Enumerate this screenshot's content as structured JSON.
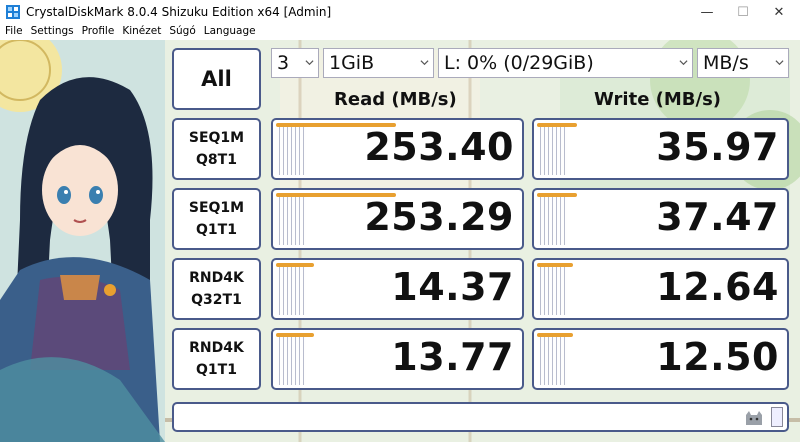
{
  "window": {
    "title": "CrystalDiskMark 8.0.4 Shizuku Edition x64 [Admin]",
    "minimize_glyph": "—",
    "maximize_glyph": "☐",
    "close_glyph": "✕"
  },
  "menu": {
    "items": [
      "File",
      "Settings",
      "Profile",
      "Kinézet",
      "Súgó",
      "Language"
    ]
  },
  "controls": {
    "all_label": "All",
    "count_value": "3",
    "size_value": "1GiB",
    "drive_value": "L: 0% (0/29GiB)",
    "unit_value": "MB/s"
  },
  "columns": {
    "read": "Read (MB/s)",
    "write": "Write (MB/s)"
  },
  "tests": [
    {
      "line1": "SEQ1M",
      "line2": "Q8T1",
      "read": "253.40",
      "write": "35.97"
    },
    {
      "line1": "SEQ1M",
      "line2": "Q1T1",
      "read": "253.29",
      "write": "37.47"
    },
    {
      "line1": "RND4K",
      "line2": "Q32T1",
      "read": "14.37",
      "write": "12.64"
    },
    {
      "line1": "RND4K",
      "line2": "Q1T1",
      "read": "13.77",
      "write": "12.50"
    }
  ],
  "theme": {
    "accent": "#e8a030",
    "border": "#4a5a8a",
    "app_icon": "crystaldiskmark-icon",
    "status_icon": "cat-icon"
  }
}
